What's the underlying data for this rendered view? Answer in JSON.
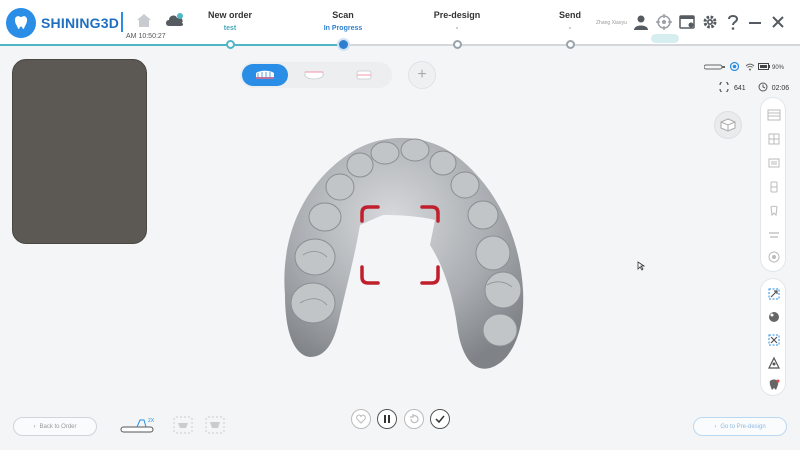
{
  "app": {
    "brand": "SHINING3D",
    "clock": "AM 10:50:27",
    "user": "Zhang Xiaoyu"
  },
  "steps": [
    {
      "title": "New order",
      "sub": "test",
      "state": "done"
    },
    {
      "title": "Scan",
      "sub": "In Progress",
      "state": "active"
    },
    {
      "title": "Pre-design",
      "sub": "-",
      "state": "pending"
    },
    {
      "title": "Send",
      "sub": "-",
      "state": "pending"
    }
  ],
  "status": {
    "battery": "90%",
    "count": "641",
    "timer": "02:06"
  },
  "footer": {
    "back_label": "Back to Order",
    "next_label": "Go to Pre-design",
    "scanner_badge": "2X"
  },
  "colors": {
    "accent": "#2a8ee6",
    "progress": "#4fb6c8",
    "focus_frame": "#c0202d",
    "camera_bg": "#5c5854"
  },
  "icons": {
    "home": "home-icon",
    "cloud": "cloud-icon",
    "user": "user-icon",
    "settings": "gear-icon",
    "help": "question-icon",
    "minimize": "minimize-icon",
    "close": "close-icon"
  }
}
